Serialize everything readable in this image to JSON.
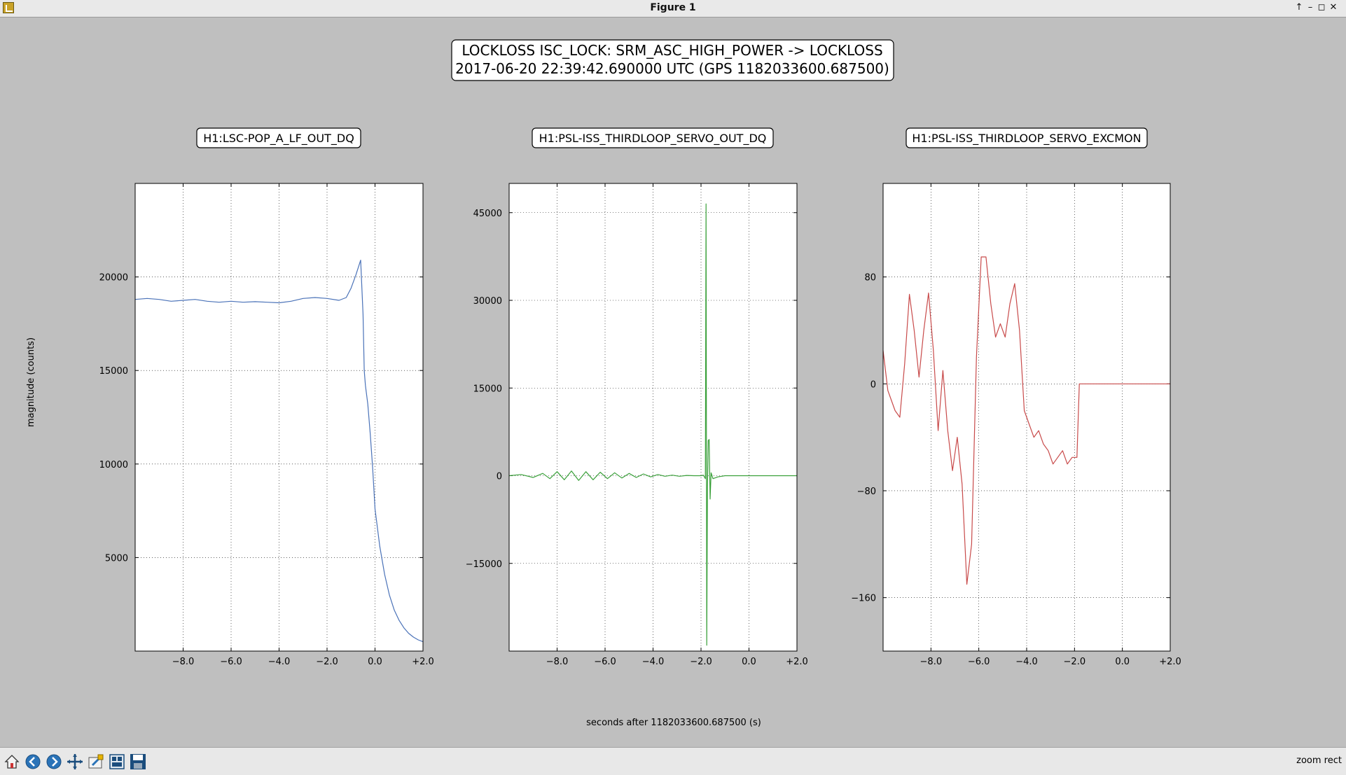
{
  "window": {
    "title": "Figure 1",
    "controls": [
      "↑",
      "–",
      "◻",
      "✕"
    ]
  },
  "figure": {
    "suptitle_line1": "LOCKLOSS ISC_LOCK: SRM_ASC_HIGH_POWER -> LOCKLOSS",
    "suptitle_line2": "2017-06-20 22:39:42.690000 UTC (GPS 1182033600.687500)",
    "ylabel": "magnitude (counts)",
    "xlabel": "seconds after 1182033600.687500 (s)"
  },
  "toolbar": {
    "buttons": [
      "home-icon",
      "back-arrow-icon",
      "forward-arrow-icon",
      "pan-icon",
      "zoom-rect-icon",
      "subplots-config-icon",
      "save-icon"
    ],
    "status": "zoom rect"
  },
  "colors": {
    "background": "#bfbfbf",
    "series1": "#4a72b8",
    "series2": "#3aa03a",
    "series3": "#c84a4a"
  },
  "chart_data": [
    {
      "type": "line",
      "title": "H1:LSC-POP_A_LF_OUT_DQ",
      "xlim": [
        -10,
        2
      ],
      "ylim": [
        0,
        25000
      ],
      "xticks": [
        -8,
        -6,
        -4,
        -2,
        0,
        2
      ],
      "xticklabels": [
        "−8.0",
        "−6.0",
        "−4.0",
        "−2.0",
        "0.0",
        "+2.0"
      ],
      "yticks": [
        5000,
        10000,
        15000,
        20000
      ],
      "yticklabels": [
        "5000",
        "10000",
        "15000",
        "20000"
      ],
      "grid": true,
      "color": "#4a72b8",
      "series": [
        {
          "x": [
            -10,
            -9.5,
            -9,
            -8.5,
            -8,
            -7.5,
            -7,
            -6.5,
            -6,
            -5.5,
            -5,
            -4.5,
            -4,
            -3.5,
            -3,
            -2.5,
            -2,
            -1.5,
            -1.2,
            -1,
            -0.8,
            -0.6,
            -0.5,
            -0.45,
            -0.4,
            -0.3,
            -0.2,
            -0.1,
            0,
            0.2,
            0.4,
            0.6,
            0.8,
            1.0,
            1.2,
            1.4,
            1.6,
            1.8,
            2.0
          ],
          "y": [
            18800,
            18850,
            18800,
            18700,
            18750,
            18800,
            18700,
            18650,
            18700,
            18650,
            18680,
            18650,
            18620,
            18700,
            18850,
            18900,
            18850,
            18750,
            18900,
            19400,
            20100,
            20900,
            18000,
            15000,
            14200,
            13200,
            11600,
            9800,
            7600,
            5600,
            4100,
            3000,
            2200,
            1650,
            1250,
            950,
            750,
            600,
            500
          ]
        }
      ]
    },
    {
      "type": "line",
      "title": "H1:PSL-ISS_THIRDLOOP_SERVO_OUT_DQ",
      "xlim": [
        -10,
        2
      ],
      "ylim": [
        -30000,
        50000
      ],
      "xticks": [
        -8,
        -6,
        -4,
        -2,
        0,
        2
      ],
      "xticklabels": [
        "−8.0",
        "−6.0",
        "−4.0",
        "−2.0",
        "0.0",
        "+2.0"
      ],
      "yticks": [
        -15000,
        0,
        15000,
        30000,
        45000
      ],
      "yticklabels": [
        "−15000",
        "0",
        "15000",
        "30000",
        "45000"
      ],
      "grid": true,
      "color": "#3aa03a",
      "series": [
        {
          "x": [
            -10,
            -9.5,
            -9,
            -8.6,
            -8.3,
            -8,
            -7.7,
            -7.4,
            -7.1,
            -6.8,
            -6.5,
            -6.2,
            -5.9,
            -5.6,
            -5.3,
            -5,
            -4.7,
            -4.4,
            -4.1,
            -3.8,
            -3.5,
            -3.2,
            -2.9,
            -2.6,
            -2.3,
            -2.0,
            -1.9,
            -1.82,
            -1.79,
            -1.76,
            -1.73,
            -1.7,
            -1.66,
            -1.62,
            -1.58,
            -1.5,
            -1.3,
            -1.0,
            0,
            1,
            2
          ],
          "y": [
            0,
            200,
            -300,
            400,
            -500,
            700,
            -700,
            800,
            -800,
            700,
            -700,
            600,
            -500,
            500,
            -400,
            400,
            -300,
            300,
            -200,
            200,
            -100,
            100,
            -100,
            50,
            0,
            0,
            100,
            -500,
            46500,
            -29000,
            -2000,
            6000,
            6200,
            -4000,
            500,
            -500,
            -200,
            0,
            0,
            0,
            0
          ]
        }
      ]
    },
    {
      "type": "line",
      "title": "H1:PSL-ISS_THIRDLOOP_SERVO_EXCMON",
      "xlim": [
        -10,
        2
      ],
      "ylim": [
        -200,
        150
      ],
      "xticks": [
        -8,
        -6,
        -4,
        -2,
        0,
        2
      ],
      "xticklabels": [
        "−8.0",
        "−6.0",
        "−4.0",
        "−2.0",
        "0.0",
        "+2.0"
      ],
      "yticks": [
        -160,
        -80,
        0,
        80
      ],
      "yticklabels": [
        "−160",
        "−80",
        "0",
        "80"
      ],
      "grid": true,
      "color": "#c84a4a",
      "series": [
        {
          "x": [
            -10,
            -9.8,
            -9.5,
            -9.3,
            -9.1,
            -8.9,
            -8.7,
            -8.5,
            -8.3,
            -8.1,
            -7.9,
            -7.7,
            -7.5,
            -7.3,
            -7.1,
            -6.9,
            -6.7,
            -6.5,
            -6.3,
            -6.1,
            -5.9,
            -5.7,
            -5.5,
            -5.3,
            -5.1,
            -4.9,
            -4.7,
            -4.5,
            -4.3,
            -4.1,
            -3.9,
            -3.7,
            -3.5,
            -3.3,
            -3.1,
            -2.9,
            -2.7,
            -2.5,
            -2.3,
            -2.1,
            -1.9,
            -1.8,
            -1.78,
            0,
            2
          ],
          "y": [
            25,
            -5,
            -20,
            -25,
            15,
            67,
            40,
            5,
            40,
            68,
            25,
            -35,
            10,
            -35,
            -65,
            -40,
            -75,
            -150,
            -120,
            20,
            95,
            95,
            60,
            35,
            45,
            35,
            60,
            75,
            40,
            -20,
            -30,
            -40,
            -35,
            -45,
            -50,
            -60,
            -55,
            -50,
            -60,
            -55,
            -55,
            0,
            0,
            0,
            0
          ]
        }
      ]
    }
  ]
}
